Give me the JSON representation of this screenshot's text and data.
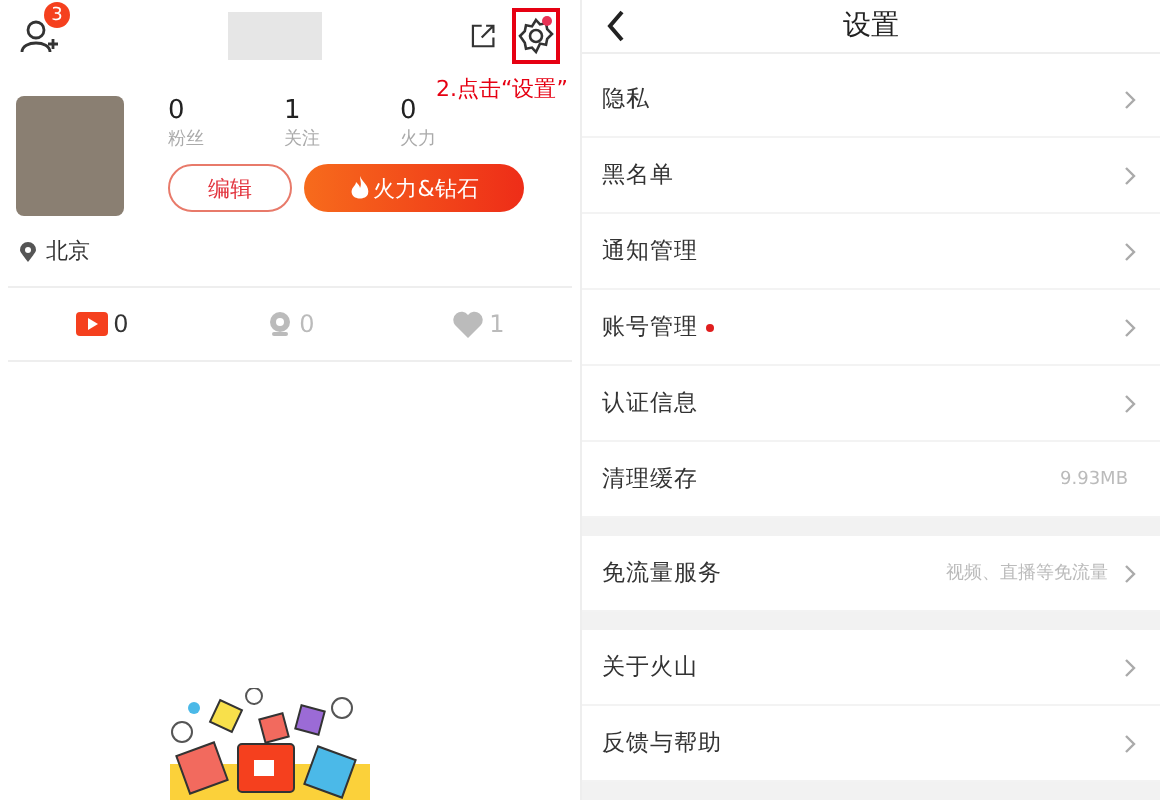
{
  "profile": {
    "follow_badge": "3",
    "annotation": "2.点击“设置”",
    "stats": [
      {
        "value": "0",
        "label": "粉丝"
      },
      {
        "value": "1",
        "label": "关注"
      },
      {
        "value": "0",
        "label": "火力"
      }
    ],
    "edit_button": "编辑",
    "fire_button": "火力&钻石",
    "location": "北京",
    "tabs": [
      {
        "kind": "video",
        "count": "0",
        "selected": true
      },
      {
        "kind": "live",
        "count": "0",
        "selected": false
      },
      {
        "kind": "like",
        "count": "1",
        "selected": false
      }
    ]
  },
  "settings": {
    "title": "设置",
    "groups": [
      [
        {
          "label": "隐私",
          "chevron": true,
          "dot": false
        },
        {
          "label": "黑名单",
          "chevron": true,
          "dot": false
        },
        {
          "label": "通知管理",
          "chevron": true,
          "dot": false
        },
        {
          "label": "账号管理",
          "chevron": true,
          "dot": true
        },
        {
          "label": "认证信息",
          "chevron": true,
          "dot": false
        },
        {
          "label": "清理缓存",
          "value": "9.93MB",
          "chevron": false,
          "dot": false
        }
      ],
      [
        {
          "label": "免流量服务",
          "value": "视频、直播等免流量",
          "chevron": true,
          "dot": false
        }
      ],
      [
        {
          "label": "关于火山",
          "chevron": true,
          "dot": false
        },
        {
          "label": "反馈与帮助",
          "chevron": true,
          "dot": false
        }
      ]
    ]
  }
}
